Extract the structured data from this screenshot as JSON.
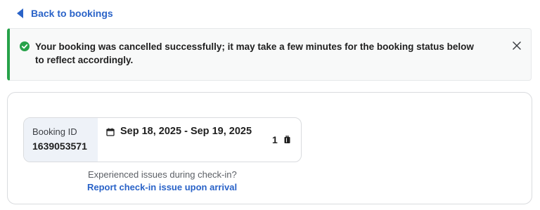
{
  "nav": {
    "back_label": "Back to bookings",
    "back_icon": "back-arrow-icon"
  },
  "alert": {
    "message": "Your booking was cancelled successfully; it may take a few minutes for the booking status below to reflect accordingly.",
    "status_icon": "check-circle-icon",
    "close_icon": "close-icon",
    "accent_color": "#27a24a"
  },
  "booking": {
    "id_label": "Booking ID",
    "id_value": "1639053571",
    "date_range": "Sep 18, 2025 - Sep 19, 2025",
    "calendar_icon": "calendar-icon",
    "count": "1",
    "count_icon": "luggage-icon"
  },
  "checkin": {
    "question": "Experienced issues during check-in?",
    "link_label": "Report check-in issue upon arrival"
  },
  "colors": {
    "link": "#2a63c8",
    "id_panel_bg": "#eef2f8"
  }
}
